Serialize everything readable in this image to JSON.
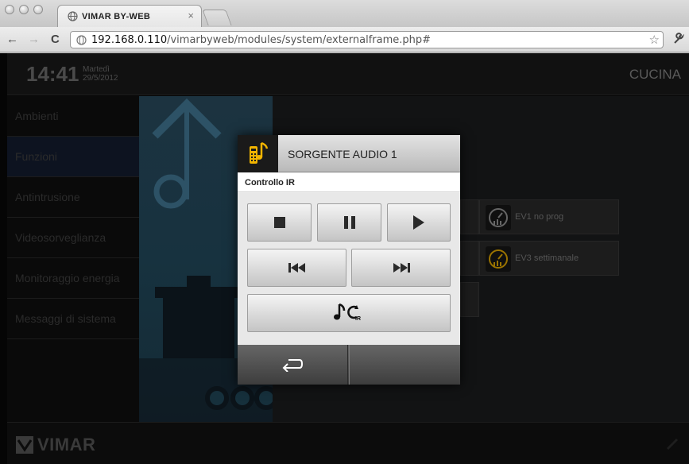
{
  "browser": {
    "tab_title": "VIMAR BY-WEB",
    "tab_close": "×",
    "url_host": "192.168.0.110",
    "url_path": "/vimarbyweb/modules/system/externalframe.php#",
    "back": "←",
    "forward": "→",
    "reload": "C",
    "bookmark": "☆",
    "wrench": "🔧"
  },
  "header": {
    "time": "14:41",
    "day": "Martedì",
    "date": "29/5/2012",
    "room": "CUCINA"
  },
  "sidebar": {
    "items": [
      {
        "label": "Ambienti"
      },
      {
        "label": "Funzioni"
      },
      {
        "label": "Antintrusione"
      },
      {
        "label": "Videosorveglianza"
      },
      {
        "label": "Monitoraggio energia"
      },
      {
        "label": "Messaggi di sistema"
      }
    ]
  },
  "tiles": [
    {
      "label": "EV1 no prog"
    },
    {
      "label": "EV3 settimanale"
    }
  ],
  "dialog": {
    "title": "SORGENTE AUDIO 1",
    "subtitle": "Controllo IR"
  },
  "footer": {
    "brand": "VIMAR"
  },
  "colors": {
    "accent": "#f2b400",
    "sidebar_active": "#0d1320"
  }
}
